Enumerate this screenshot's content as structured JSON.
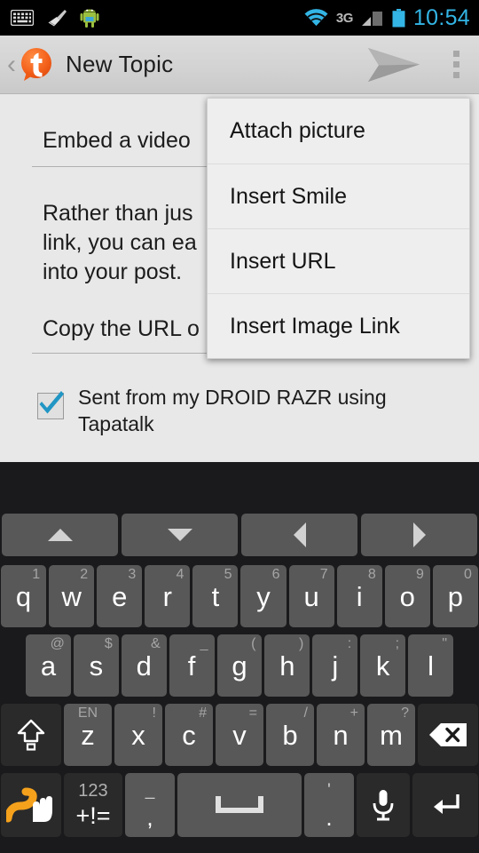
{
  "status_bar": {
    "icons_left": [
      "keyboard-icon",
      "broom-icon",
      "android-robot-icon"
    ],
    "icons_right": [
      "wifi-icon",
      "network-3g-icon",
      "signal-bars-icon",
      "battery-icon"
    ],
    "network_label": "3G",
    "clock": "10:54",
    "clock_color": "#33b5e5"
  },
  "action_bar": {
    "back_label": "‹",
    "logo_letter": "t",
    "logo_color": "#f26522",
    "title": "New Topic",
    "send_icon": "send-paper-plane-icon",
    "overflow_icon": "overflow-menu-icon"
  },
  "compose": {
    "title_value": "Embed a video ",
    "body_value": "Rather than jus\nlink, you can ea\ninto your post.",
    "url_value": "Copy the URL o",
    "signature_checked": true,
    "signature_label": "Sent from my DROID RAZR using Tapatalk",
    "checkbox_color": "#2196c4"
  },
  "overflow_menu": {
    "items": [
      {
        "label": "Attach picture"
      },
      {
        "label": "Insert Smile"
      },
      {
        "label": "Insert URL"
      },
      {
        "label": "Insert Image Link"
      }
    ]
  },
  "keyboard": {
    "arrow_row": [
      {
        "name": "arrow-up-key",
        "icon": "triangle-up-icon"
      },
      {
        "name": "arrow-down-key",
        "icon": "triangle-down-icon"
      },
      {
        "name": "arrow-left-key",
        "icon": "triangle-left-icon"
      },
      {
        "name": "arrow-right-key",
        "icon": "triangle-right-icon"
      }
    ],
    "row1": [
      {
        "main": "q",
        "alt": "1"
      },
      {
        "main": "w",
        "alt": "2"
      },
      {
        "main": "e",
        "alt": "3"
      },
      {
        "main": "r",
        "alt": "4"
      },
      {
        "main": "t",
        "alt": "5"
      },
      {
        "main": "y",
        "alt": "6"
      },
      {
        "main": "u",
        "alt": "7"
      },
      {
        "main": "i",
        "alt": "8"
      },
      {
        "main": "o",
        "alt": "9"
      },
      {
        "main": "p",
        "alt": "0"
      }
    ],
    "row2": [
      {
        "main": "a",
        "alt": "@"
      },
      {
        "main": "s",
        "alt": "$"
      },
      {
        "main": "d",
        "alt": "&"
      },
      {
        "main": "f",
        "alt": "_"
      },
      {
        "main": "g",
        "alt": "("
      },
      {
        "main": "h",
        "alt": ")"
      },
      {
        "main": "j",
        "alt": ":"
      },
      {
        "main": "k",
        "alt": ";"
      },
      {
        "main": "l",
        "alt": "\""
      }
    ],
    "row3": {
      "shift_icon": "shift-caps-icon",
      "letters": [
        {
          "main": "z",
          "alt": "EN"
        },
        {
          "main": "x",
          "alt": "!"
        },
        {
          "main": "c",
          "alt": "#"
        },
        {
          "main": "v",
          "alt": "="
        },
        {
          "main": "b",
          "alt": "/"
        },
        {
          "main": "n",
          "alt": "+"
        },
        {
          "main": "m",
          "alt": "?"
        }
      ],
      "backspace_icon": "backspace-icon"
    },
    "row4": {
      "swipe_icon": "swipe-gesture-icon",
      "symbols_top": "123",
      "symbols_bottom": "+!=",
      "comma_top": "_",
      "comma_bottom": ",",
      "space_icon": "space-bar-icon",
      "period_top": "'",
      "period_bottom": ".",
      "mic_icon": "microphone-icon",
      "enter_icon": "enter-return-icon"
    }
  }
}
